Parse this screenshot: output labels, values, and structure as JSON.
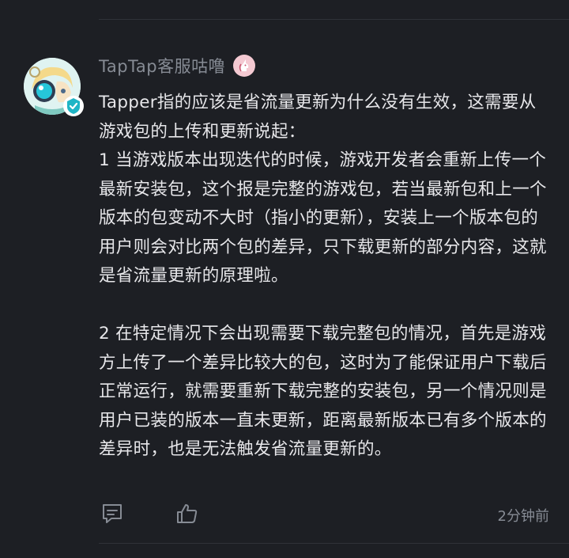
{
  "post": {
    "author": "TapTap客服咕噜",
    "badge_icon": "unicorn-badge-icon",
    "verified_icon": "verified-check-icon",
    "paragraphs": [
      "Tapper指的应该是省流量更新为什么没有生效，这需要从游戏包的上传和更新说起：\n1 当游戏版本出现迭代的时候，游戏开发者会重新上传一个最新安装包，这个报是完整的游戏包，若当最新包和上一个版本的包变动不大时（指小的更新），安装上一个版本包的用户则会对比两个包的差异，只下载更新的部分内容，这就是省流量更新的原理啦。",
      "2 在特定情况下会出现需要下载完整包的情况，首先是游戏方上传了一个差异比较大的包，这时为了能保证用户下载后正常运行，就需要重新下载完整的安装包，另一个情况则是用户已装的版本一直未更新，距离最新版本已有多个版本的差异时，也是无法触发省流量更新的。"
    ],
    "timestamp": "2分钟前"
  },
  "actions": {
    "comment_icon": "comment-icon",
    "like_icon": "thumbs-up-icon"
  },
  "colors": {
    "background": "#1d1f24",
    "text": "#e7e7ea",
    "muted": "#868b94",
    "verified": "#1fb5c6",
    "badge": "#f4c9d2"
  }
}
